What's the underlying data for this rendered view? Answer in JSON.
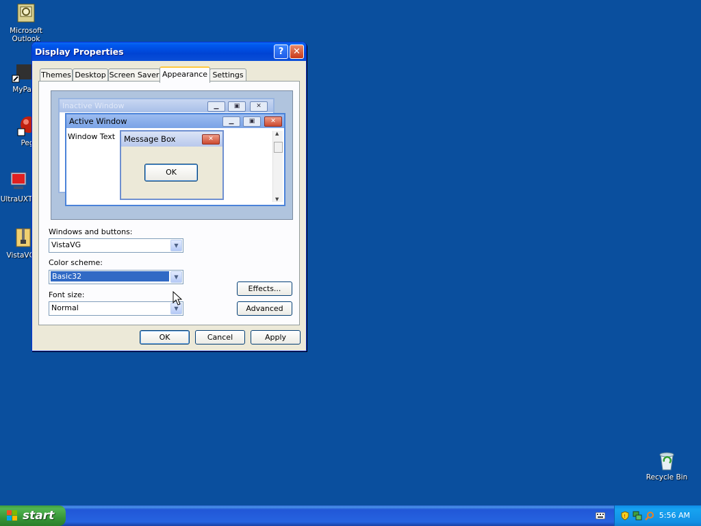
{
  "desktop": {
    "icons": [
      {
        "label": "Microsoft Outlook"
      },
      {
        "label": "MyPa"
      },
      {
        "label": "Peg"
      },
      {
        "label": "UltraUXT"
      },
      {
        "label": "VistaVG-"
      },
      {
        "label": "Recycle Bin"
      }
    ]
  },
  "window": {
    "title": "Display Properties",
    "help_glyph": "?",
    "close_glyph": "✕",
    "tabs": [
      {
        "label": "Themes",
        "active": false
      },
      {
        "label": "Desktop",
        "active": false
      },
      {
        "label": "Screen Saver",
        "active": false
      },
      {
        "label": "Appearance",
        "active": true
      },
      {
        "label": "Settings",
        "active": false
      }
    ],
    "preview": {
      "inactive_title": "Inactive Window",
      "active_title": "Active Window",
      "window_text": "Window Text",
      "message_box_title": "Message Box",
      "ok_label": "OK"
    },
    "windows_and_buttons": {
      "label": "Windows and buttons:",
      "value": "VistaVG"
    },
    "color_scheme": {
      "label": "Color scheme:",
      "value": "Basic32"
    },
    "font_size": {
      "label": "Font size:",
      "value": "Normal"
    },
    "effects_label": "Effects...",
    "advanced_label": "Advanced",
    "ok_label": "OK",
    "cancel_label": "Cancel",
    "apply_label": "Apply"
  },
  "taskbar": {
    "start_label": "start",
    "clock": "5:56 AM"
  },
  "colors": {
    "desktop": "#0a4f9e",
    "titlebar": "#0058ee",
    "selection": "#316ac5"
  }
}
